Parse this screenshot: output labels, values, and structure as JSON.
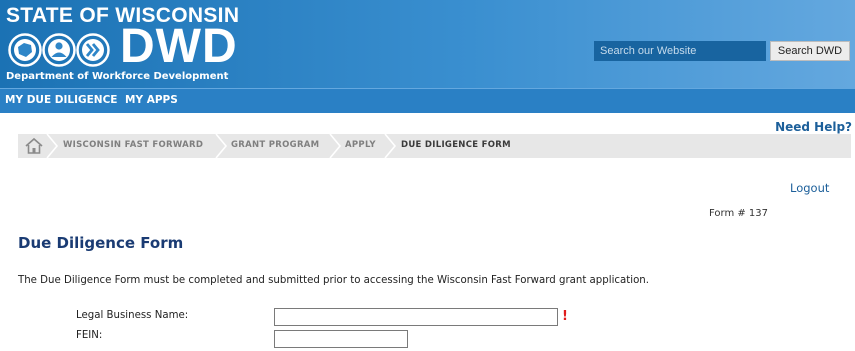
{
  "header": {
    "state_text": "STATE OF WISCONSIN",
    "logo_text": "DWD",
    "department": "Department of Workforce Development",
    "search_placeholder": "Search our Website",
    "search_button": "Search DWD",
    "colors": {
      "header_blue": "#1b72b4",
      "nav_blue": "#2a80c5",
      "title_navy": "#1a3b73"
    }
  },
  "nav": {
    "items": [
      "MY DUE DILIGENCE",
      "MY APPS"
    ]
  },
  "help": {
    "label": "Need Help?"
  },
  "breadcrumb": {
    "home_icon": "house-icon",
    "items": [
      "WISCONSIN FAST FORWARD",
      "GRANT PROGRAM",
      "APPLY",
      "DUE DILIGENCE FORM"
    ]
  },
  "account": {
    "logout": "Logout"
  },
  "form": {
    "number": "Form # 137",
    "title": "Due Diligence Form",
    "intro": "The Due Diligence Form must be completed and submitted prior to accessing the Wisconsin Fast Forward grant application.",
    "fields": [
      {
        "label": "Legal Business Name:",
        "value": "",
        "required_mark": "!"
      },
      {
        "label": "FEIN:",
        "value": ""
      }
    ]
  }
}
